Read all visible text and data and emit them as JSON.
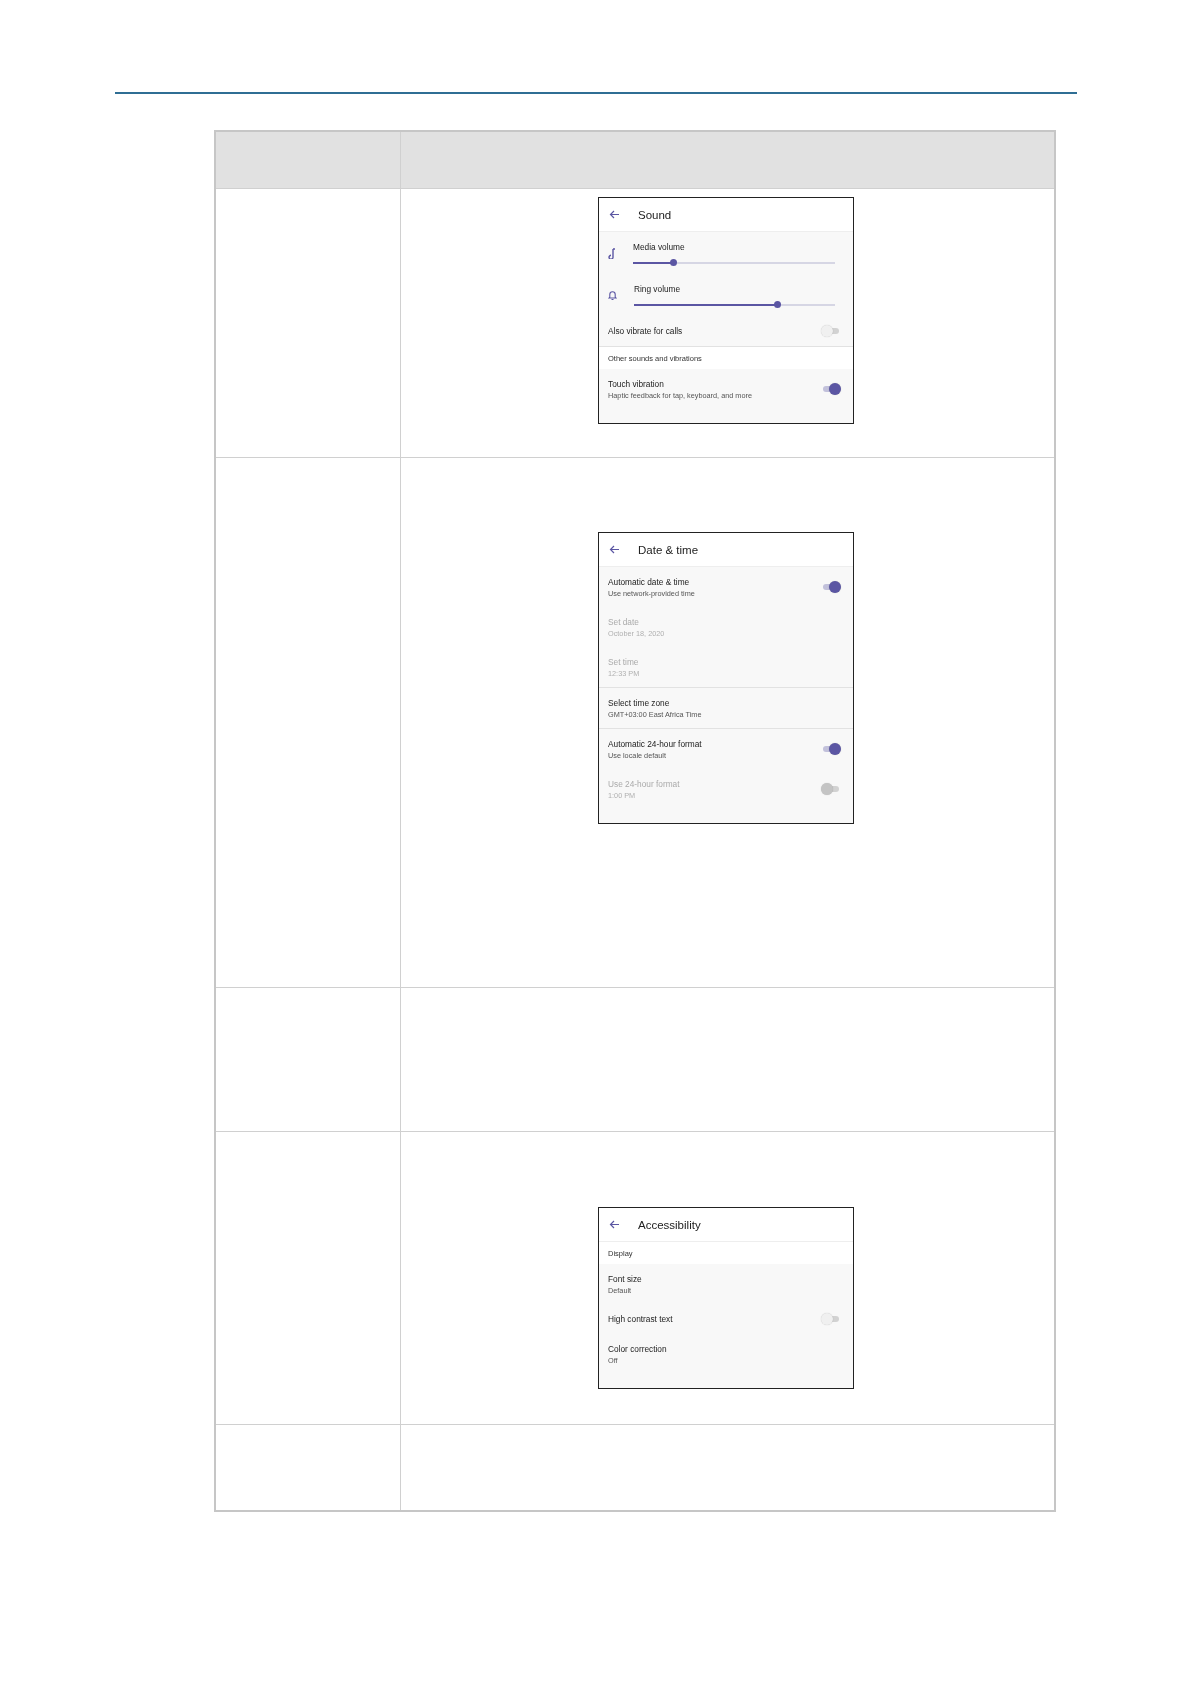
{
  "screens": [
    {
      "title": "Sound",
      "items": [
        {
          "kind": "slider",
          "title": "Media volume",
          "level": 0.2
        },
        {
          "kind": "slider",
          "title": "Ring volume",
          "level": 0.71
        },
        {
          "kind": "toggle",
          "title": "Also vibrate for calls",
          "on": false,
          "disabled": false
        },
        {
          "kind": "section",
          "title": "Other sounds and vibrations",
          "divided": true
        },
        {
          "kind": "toggle",
          "title": "Touch vibration",
          "subtitle": "Haptic feedback for tap, keyboard, and more",
          "on": true,
          "disabled": false
        }
      ]
    },
    {
      "title": "Date & time",
      "items": [
        {
          "kind": "toggle",
          "title": "Automatic date & time",
          "subtitle": "Use network-provided time",
          "on": true,
          "disabled": false
        },
        {
          "kind": "text",
          "title": "Set date",
          "subtitle": "October 18, 2020",
          "disabled": true
        },
        {
          "kind": "text",
          "title": "Set time",
          "subtitle": "12:33 PM",
          "disabled": true
        },
        {
          "kind": "text",
          "title": "Select time zone",
          "subtitle": "GMT+03:00 East Africa Time",
          "disabled": false,
          "divided": true
        },
        {
          "kind": "toggle",
          "title": "Automatic 24-hour format",
          "subtitle": "Use locale default",
          "on": true,
          "disabled": false,
          "divided": true
        },
        {
          "kind": "toggle",
          "title": "Use 24-hour format",
          "subtitle": "1:00 PM",
          "on": false,
          "disabled": true
        }
      ]
    },
    {
      "title": "Accessibility",
      "items": [
        {
          "kind": "section",
          "title": "Display"
        },
        {
          "kind": "text",
          "title": "Font size",
          "subtitle": "Default",
          "disabled": false
        },
        {
          "kind": "toggle",
          "title": "High contrast text",
          "on": false,
          "disabled": false
        },
        {
          "kind": "text",
          "title": "Color correction",
          "subtitle": "Off",
          "disabled": false
        }
      ]
    }
  ]
}
